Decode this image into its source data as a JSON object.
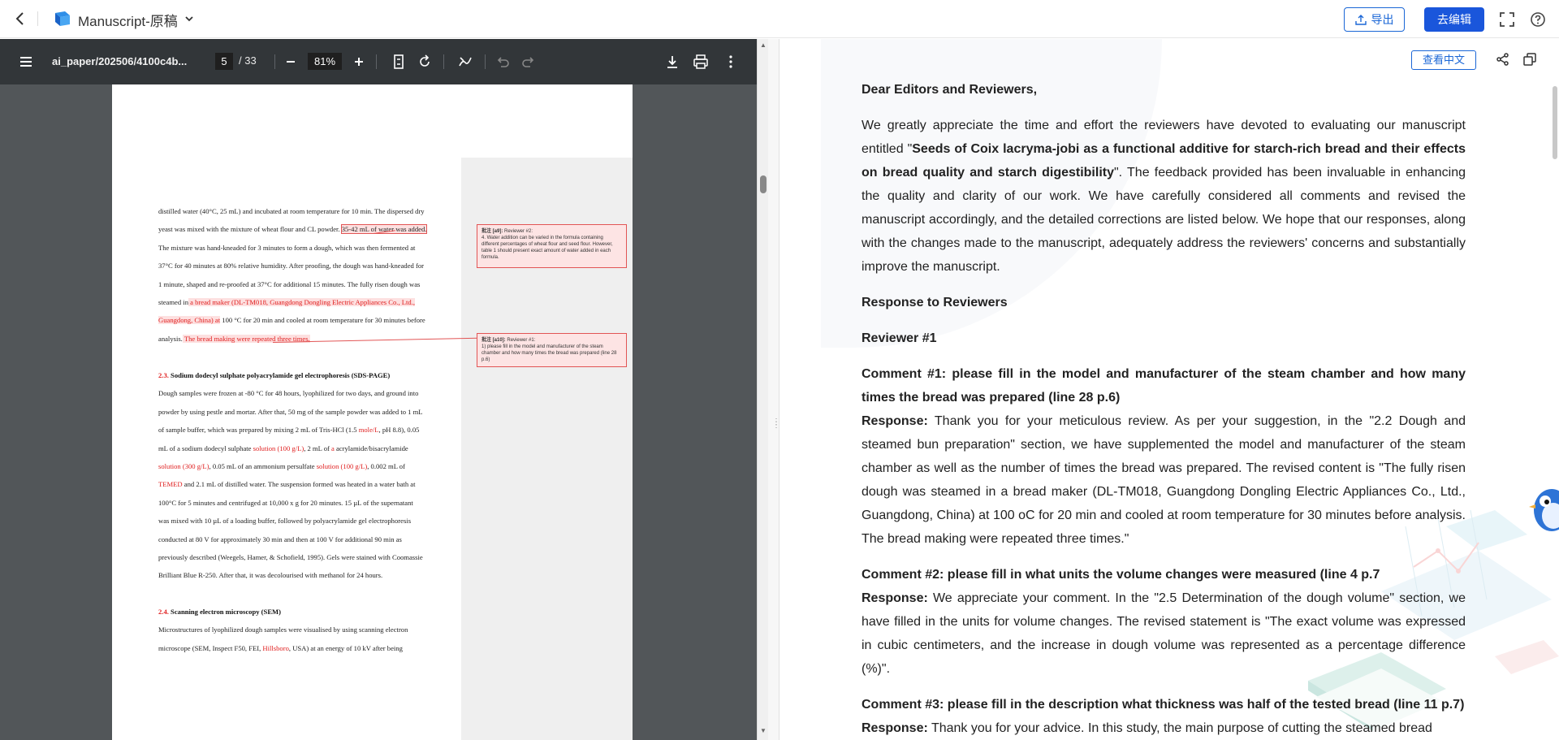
{
  "app": {
    "title": "Manuscript-原稿",
    "export_label": "导出",
    "edit_label": "去编辑",
    "brand_color": "#1a56db"
  },
  "pdf_toolbar": {
    "filename": "ai_paper/202506/4100c4b...",
    "current_page": "5",
    "page_total": "/ 33",
    "zoom": "81%"
  },
  "pdf_page": {
    "paragraph1": [
      "distilled water (40°C, 25 mL) and incubated at room temperature for 10 min. The dispersed dry",
      "yeast was mixed with the mixture of wheat flour and CL powder. ",
      "35-42 mL of water was added.",
      "The mixture was hand-kneaded for 3 minutes to form a dough, which was then fermented at",
      "37°C for 40 minutes at 80% relative humidity. After proofing, the dough was hand-kneaded for",
      "1 minute, shaped and re-proofed at 37°C for additional 15 minutes. The fully risen dough was",
      "steamed in",
      " a bread maker (DL-TM018, Guangdong Dongling Electric Appliances Co., Ltd.,",
      "Guangdong, China) at",
      " 100 °C for 20 min and cooled at room temperature for 30 minutes before",
      "analysis.",
      " The bread making were repeated three times."
    ],
    "section23_num": "2.3.",
    "section23_title": "Sodium dodecyl sulphate polyacrylamide gel electrophoresis (SDS-PAGE)",
    "section23_lines": [
      "Dough samples were frozen at -80 °C for 48 hours, lyophilized for two days, and ground into",
      "powder by using pestle and mortar. After that, 50 mg of the sample powder was added to 1 mL",
      "of sample buffer, which was prepared by mixing 2 mL of Tris-HCl (1.5 ",
      "mole/L",
      ", pH 8.8), 0.05",
      "mL of a sodium dodecyl sulphate ",
      "solution (100 g/L)",
      ", 2 mL of ",
      "a",
      " acrylamide/bisacrylamide",
      "solution (300 g/L)",
      ", 0.05 mL of an ammonium persulfate ",
      "solution (100 g/L)",
      ", 0.002 mL of",
      "TEMED",
      " and 2.1 mL of distilled water. The suspension formed was heated in a water bath at",
      "100°C for 5 minutes and centrifuged at 10,000 x g for 20 minutes. 15 µL of the supernatant",
      "was mixed with 10 µL of a loading buffer, followed by polyacrylamide gel electrophoresis",
      "conducted at 80 V for approximately 30 min and then at 100 V for additional 90 min as",
      "previously described (Weegels, Hamer, & Schofield, 1995). Gels were stained with Coomassie",
      "Brilliant Blue R-250. After that, it was decolourised with methanol for 24 hours."
    ],
    "section24_num": "2.4.",
    "section24_title": "Scanning electron microscopy (SEM)",
    "section24_lines": [
      "Microstructures of lyophilized dough samples were visualised by using scanning electron",
      "microscope (SEM, Inspect F50, FEI, ",
      "Hillsboro",
      ", USA) at an energy of 10 kV after being"
    ],
    "note1_head": "批注 [a9]:",
    "note1_reviewer": " Reviewer #2:",
    "note1_body": "4. Water addition can be varied in the formula containing different percentages of wheat flour and seed flour. However, table 1 should present exact amount of water added in each formula.",
    "note2_head": "批注 [a10]:",
    "note2_reviewer": " Reviewer #1:",
    "note2_body": "1) please fill in the model and manufacturer of the steam chamber and how many times the bread was prepared (line 28 p.6)"
  },
  "right_panel": {
    "view_chinese": "查看中文",
    "greeting": "Dear Editors and Reviewers,",
    "intro_a": "We greatly appreciate the time and effort the reviewers have devoted to evaluating our manuscript entitled \"",
    "intro_title": "Seeds of Coix lacryma-jobi as a functional additive for starch-rich bread and their effects on bread quality and starch digestibility",
    "intro_b": "\". The feedback provided has been invaluable in enhancing the quality and clarity of our work. We have carefully considered all comments and revised the manuscript accordingly, and the detailed corrections are listed below. We hope that our responses, along with the changes made to the manuscript, adequately address the reviewers' concerns and substantially improve the manuscript.",
    "response_heading": "Response to Reviewers",
    "reviewer1": "Reviewer #1",
    "c1_label": "Comment #1: please fill in the model and manufacturer of the steam chamber and how many times the bread was prepared (line 28 p.6)",
    "c1_resp_label": "Response:",
    "c1_resp": " Thank you for your meticulous review. As per your suggestion, in the \"2.2 Dough and steamed bun preparation\" section, we have supplemented the model and manufacturer of the steam chamber as well as the number of times the bread was prepared. The revised content is \"The fully risen dough was steamed in a bread maker (DL-TM018, Guangdong Dongling Electric Appliances Co., Ltd., Guangdong, China) at 100 oC for 20 min and cooled at room temperature for 30 minutes before analysis. The bread making were repeated three times.\"",
    "c2_label": "Comment #2: please fill in what units the volume changes were measured (line 4 p.7",
    "c2_resp_label": "Response:",
    "c2_resp": " We appreciate your comment. In the \"2.5 Determination of the dough volume\" section, we have filled in the units for volume changes. The revised statement is \"The exact volume was expressed in cubic centimeters, and the increase in dough volume was represented as a percentage difference (%)\".",
    "c3_label": "Comment #3: please fill in the description what thickness was half of the tested bread (line 11 p.7)",
    "c3_resp_label": "Response:",
    "c3_resp": " Thank you for your advice. In this study, the main purpose of cutting the steamed bread"
  }
}
